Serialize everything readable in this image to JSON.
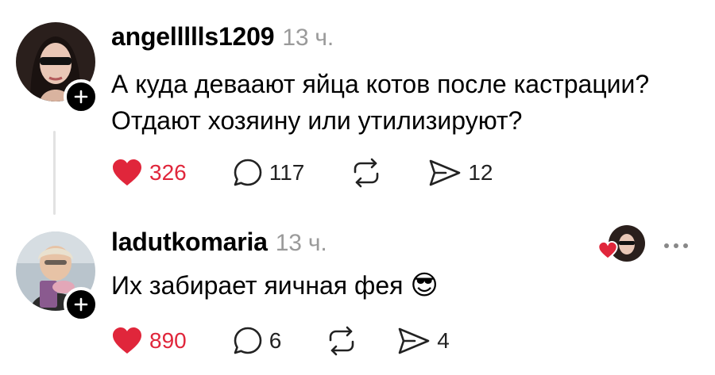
{
  "posts": [
    {
      "username": "angellllls1209",
      "time": "13 ч.",
      "text_lines": [
        "А куда деваают яйца котов после кастрации?",
        "Отдают хозяину или утилизируют?"
      ],
      "likes": "326",
      "replies": "117",
      "shares": "12",
      "liked": true
    },
    {
      "username": "ladutkomaria",
      "time": "13 ч.",
      "text": "Их забирает яичная фея",
      "emoji": "😎",
      "likes": "890",
      "replies": "6",
      "shares": "4",
      "liked": true
    }
  ],
  "colors": {
    "like": "#e0263b",
    "muted": "#9a9a9a",
    "thread_line": "#e2e2e2"
  },
  "icons": [
    "heart-icon",
    "comment-icon",
    "repost-icon",
    "share-icon",
    "plus-icon",
    "more-icon"
  ]
}
